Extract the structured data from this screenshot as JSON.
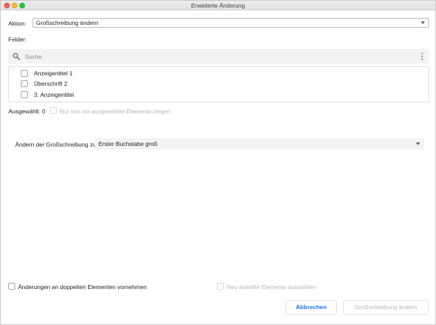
{
  "window": {
    "title": "Erweiterte Änderung"
  },
  "action": {
    "label": "Aktion:",
    "value": "Großschreibung ändern"
  },
  "fields": {
    "label": "Felder:",
    "search_placeholder": "Suche",
    "items": [
      {
        "label": "Anzeigentitel 1",
        "checked": false
      },
      {
        "label": "Überschrift 2",
        "checked": false
      },
      {
        "label": "3. Anzeigentitel",
        "checked": false
      }
    ]
  },
  "selection": {
    "count_label": "Ausgewählt: 0",
    "only_selected_label": "Nur von mir ausgewählte Elemente zeigen"
  },
  "case_change": {
    "label": "Ändern der Großschreibung zu:",
    "value": "Erster Buchstabe groß"
  },
  "options": {
    "duplicates_label": "Änderungen an doppelten Elementen vornehmen",
    "select_new_label": "Neu erstellte Elemente auswählen"
  },
  "buttons": {
    "cancel": "Abbrechen",
    "apply": "Großschreibung ändern"
  },
  "colors": {
    "accent": "#1a73e8",
    "disabled_text": "#b4b6b9"
  }
}
